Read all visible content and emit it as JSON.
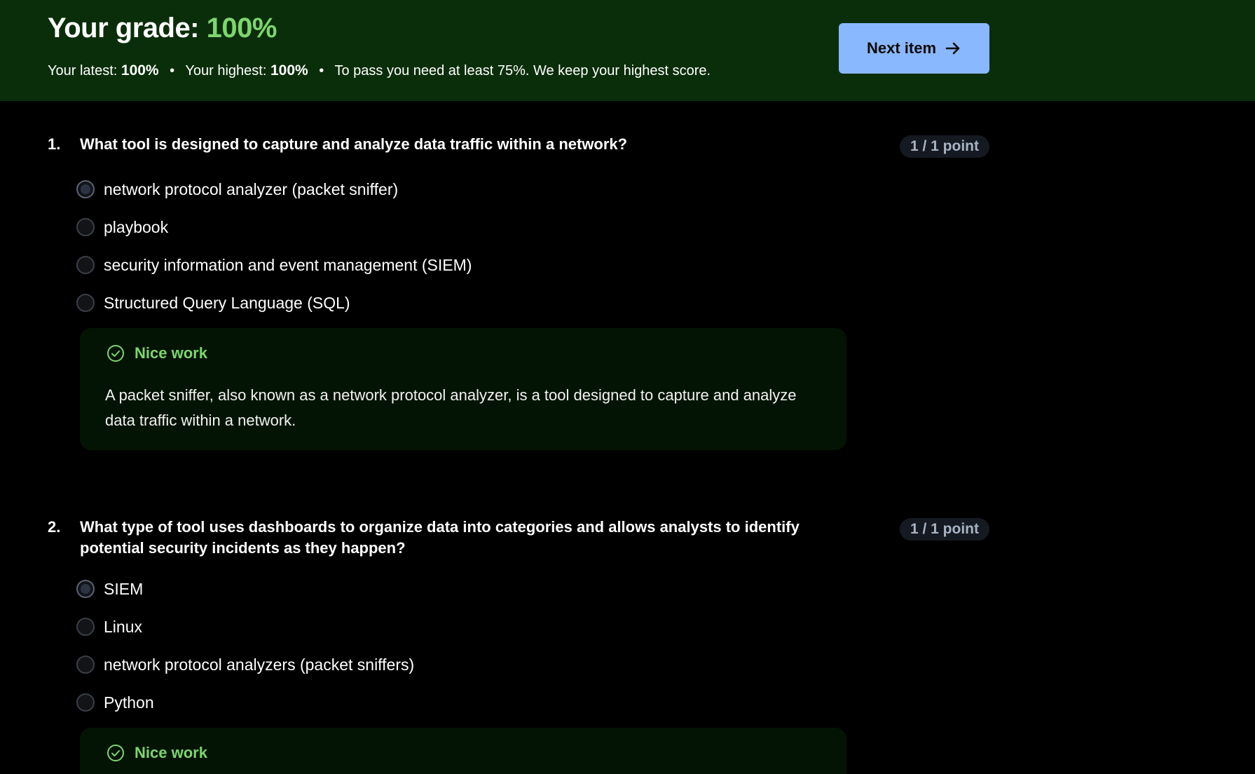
{
  "header": {
    "grade_label": "Your grade:",
    "grade_value": "100%",
    "latest_label": "Your latest:",
    "latest_value": "100%",
    "highest_label": "Your highest:",
    "highest_value": "100%",
    "pass_note": "To pass you need at least 75%. We keep your highest score.",
    "next_button_label": "Next item",
    "colors": {
      "banner": "#0b2e0a",
      "accent_green": "#7ed56f",
      "button": "#8ab8ff"
    }
  },
  "questions": [
    {
      "number": "1.",
      "text": "What tool is designed to capture and analyze data traffic within a network?",
      "points": "1 / 1 point",
      "options": [
        {
          "label": "network protocol analyzer (packet sniffer)",
          "selected": true
        },
        {
          "label": "playbook",
          "selected": false
        },
        {
          "label": "security information and event management (SIEM)",
          "selected": false
        },
        {
          "label": "Structured Query Language (SQL)",
          "selected": false
        }
      ],
      "feedback": {
        "title": "Nice work",
        "icon": "check-circle-icon",
        "body": "A packet sniffer, also known as a network protocol analyzer, is a tool designed to capture and analyze data traffic within a network."
      }
    },
    {
      "number": "2.",
      "text": "What type of tool uses dashboards to organize data into categories and allows analysts to identify potential security incidents as they happen?",
      "points": "1 / 1 point",
      "options": [
        {
          "label": "SIEM",
          "selected": true
        },
        {
          "label": "Linux",
          "selected": false
        },
        {
          "label": "network protocol analyzers (packet sniffers)",
          "selected": false
        },
        {
          "label": "Python",
          "selected": false
        }
      ],
      "feedback": {
        "title": "Nice work",
        "icon": "check-circle-icon"
      }
    }
  ]
}
